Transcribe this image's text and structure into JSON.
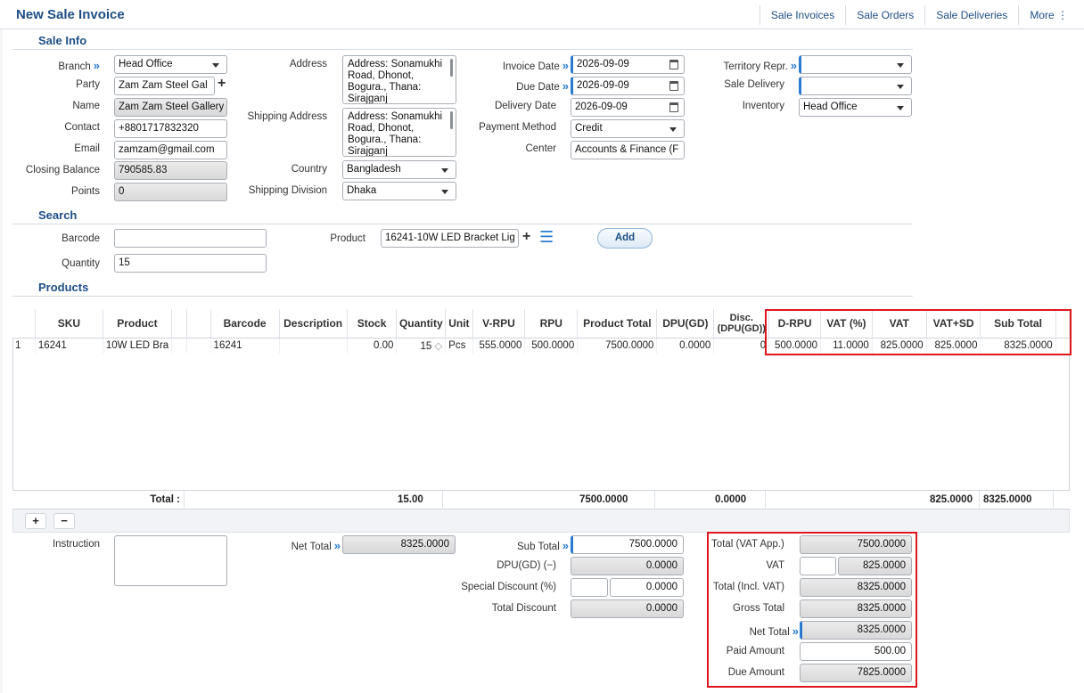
{
  "header": {
    "title": "New Sale Invoice",
    "links": [
      "Sale Invoices",
      "Sale Orders",
      "Sale Deliveries",
      "More ⋮"
    ]
  },
  "sale_info": {
    "section_title": "Sale Info",
    "branch": {
      "label": "Branch",
      "value": "Head Office"
    },
    "party": {
      "label": "Party",
      "value": "Zam Zam Steel Gal"
    },
    "name": {
      "label": "Name",
      "value": "Zam Zam Steel Gallery ("
    },
    "contact": {
      "label": "Contact",
      "value": "+8801717832320"
    },
    "email": {
      "label": "Email",
      "value": "zamzam@gmail.com"
    },
    "closing_balance": {
      "label": "Closing Balance",
      "value": "790585.83"
    },
    "points": {
      "label": "Points",
      "value": "0"
    },
    "address": {
      "label": "Address",
      "value": "Address: Sonamukhi Road, Dhonot, Bogura., Thana: Sirajganj"
    },
    "shipping_address": {
      "label": "Shipping Address",
      "value": "Address: Sonamukhi Road, Dhonot, Bogura., Thana: Sirajganj"
    },
    "country": {
      "label": "Country",
      "value": "Bangladesh"
    },
    "shipping_division": {
      "label": "Shipping Division",
      "value": "Dhaka"
    },
    "invoice_date": {
      "label": "Invoice Date",
      "value": "2026-09-09"
    },
    "due_date": {
      "label": "Due Date",
      "value": "2026-09-09"
    },
    "delivery_date": {
      "label": "Delivery Date",
      "value": "2026-09-09"
    },
    "payment_method": {
      "label": "Payment Method",
      "value": "Credit"
    },
    "center": {
      "label": "Center",
      "value": "Accounts & Finance (F"
    },
    "territory_repr": {
      "label": "Territory Repr.",
      "value": ""
    },
    "sale_delivery": {
      "label": "Sale Delivery",
      "value": ""
    },
    "inventory": {
      "label": "Inventory",
      "value": "Head Office"
    }
  },
  "search": {
    "section_title": "Search",
    "barcode": {
      "label": "Barcode",
      "value": ""
    },
    "quantity": {
      "label": "Quantity",
      "value": "15"
    },
    "product": {
      "label": "Product",
      "value": "16241-10W LED Bracket Lig"
    },
    "add_label": "Add"
  },
  "products": {
    "section_title": "Products",
    "columns": [
      "",
      "SKU",
      "Product",
      "",
      "",
      "Barcode",
      "Description",
      "Stock",
      "Quantity",
      "Unit",
      "V-RPU",
      "RPU",
      "Product Total",
      "DPU(GD)",
      "Disc. (DPU(GD))",
      "D-RPU",
      "VAT (%)",
      "VAT",
      "VAT+SD",
      "Sub Total",
      ""
    ],
    "rows": [
      [
        "1",
        "16241",
        "10W LED Bra",
        "",
        "",
        "16241",
        "",
        "0.00",
        "15",
        "Pcs",
        "555.0000",
        "500.0000",
        "7500.0000",
        "0.0000",
        "0",
        "500.0000",
        "11.0000",
        "825.0000",
        "825.0000",
        "8325.0000",
        ""
      ]
    ],
    "totals": {
      "label": "Total :",
      "quantity": "15.00",
      "product_total": "7500.0000",
      "disc": "0.0000",
      "vat_sd": "825.0000",
      "sub_total": "8325.0000"
    }
  },
  "summary": {
    "instruction_label": "Instruction",
    "net_total_label": "Net Total",
    "net_total_value": "8325.0000",
    "sub_total_label": "Sub Total",
    "sub_total_value": "7500.0000",
    "dpu_label": "DPU(GD) (−)",
    "dpu_value": "0.0000",
    "special_discount_label": "Special Discount (%)",
    "special_discount_pct": "",
    "special_discount_value": "0.0000",
    "total_discount_label": "Total Discount",
    "total_discount_value": "0.0000",
    "total_vat_app_label": "Total (VAT App.)",
    "total_vat_app_value": "7500.0000",
    "vat_label": "VAT",
    "vat_pct": "",
    "vat_value": "825.0000",
    "total_incl_vat_label": "Total (Incl. VAT)",
    "total_incl_vat_value": "8325.0000",
    "gross_total_label": "Gross Total",
    "gross_total_value": "8325.0000",
    "net_total2_label": "Net Total",
    "net_total2_value": "8325.0000",
    "paid_amount_label": "Paid Amount",
    "paid_amount_value": "500.00",
    "due_amount_label": "Due Amount",
    "due_amount_value": "7825.0000"
  },
  "colors": {
    "accent": "#1d4f86",
    "highlight": "#e0161d",
    "required": "#2a7bd0"
  }
}
